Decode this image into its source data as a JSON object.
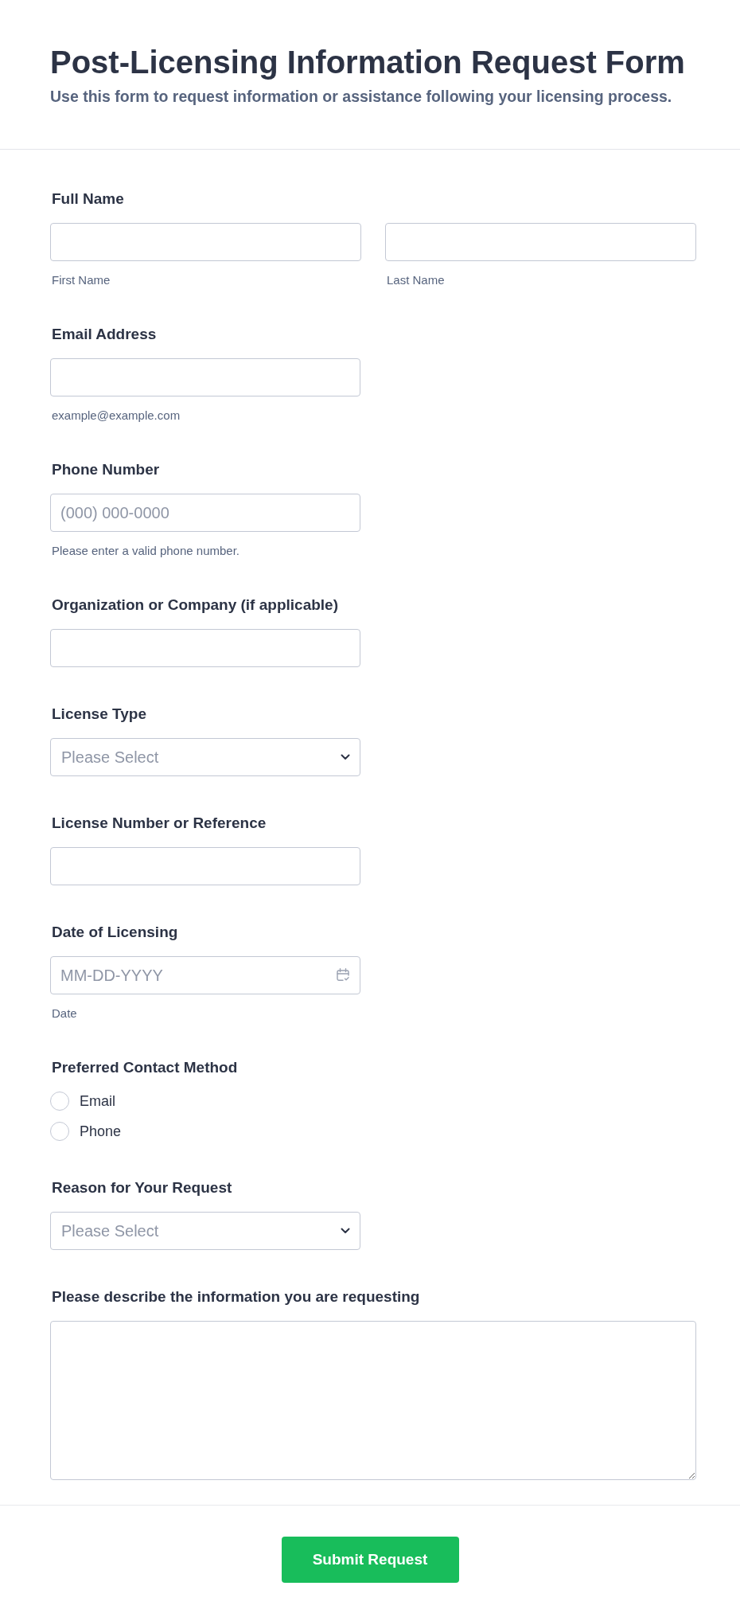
{
  "header": {
    "title": "Post-Licensing Information Request Form",
    "subtitle": "Use this form to request information or assistance following your licensing process."
  },
  "fields": [
    {
      "kind": "name",
      "label": "Full Name",
      "inputs": [
        {
          "sublabel": "First Name"
        },
        {
          "sublabel": "Last Name"
        }
      ]
    },
    {
      "kind": "text",
      "label": "Email Address",
      "sublabel": "example@example.com"
    },
    {
      "kind": "text",
      "label": "Phone Number",
      "placeholder": "(000) 000-0000",
      "sublabel": "Please enter a valid phone number."
    },
    {
      "kind": "text",
      "label": "Organization or Company (if applicable)"
    },
    {
      "kind": "select",
      "label": "License Type",
      "placeholder": "Please Select"
    },
    {
      "kind": "text",
      "label": "License Number or Reference"
    },
    {
      "kind": "date",
      "label": "Date of Licensing",
      "placeholder": "MM-DD-YYYY",
      "sublabel": "Date"
    },
    {
      "kind": "radio",
      "label": "Preferred Contact Method",
      "options": [
        {
          "label": "Email",
          "selected": false
        },
        {
          "label": "Phone",
          "selected": false
        }
      ]
    },
    {
      "kind": "select",
      "label": "Reason for Your Request",
      "placeholder": "Please Select"
    },
    {
      "kind": "textarea",
      "label": "Please describe the information you are requesting"
    }
  ],
  "submit": {
    "label": "Submit Request"
  }
}
